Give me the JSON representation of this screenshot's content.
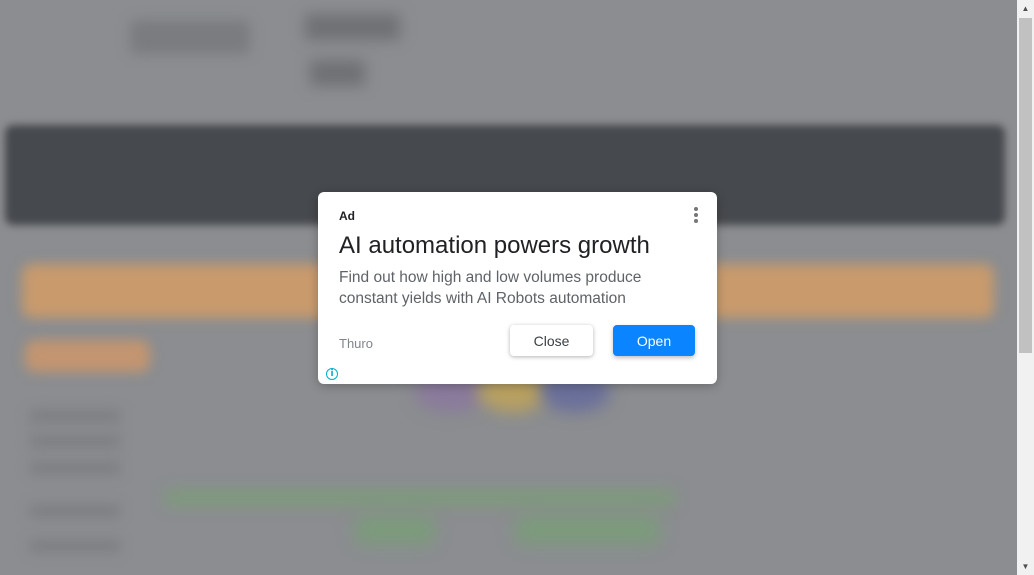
{
  "ad": {
    "label": "Ad",
    "headline": "AI automation powers growth",
    "body": "Find out how high and low volumes produce constant yields with AI Robots automation",
    "advertiser": "Thuro",
    "close_label": "Close",
    "open_label": "Open",
    "info_glyph": "i",
    "menu_icon": "more-vert-icon",
    "info_icon": "info-icon"
  },
  "colors": {
    "open_button": "#0a84ff",
    "overlay": "#8b8d90",
    "info_icon": "#00aecd"
  },
  "scrollbar": {
    "up_glyph": "▲",
    "down_glyph": "▼"
  }
}
